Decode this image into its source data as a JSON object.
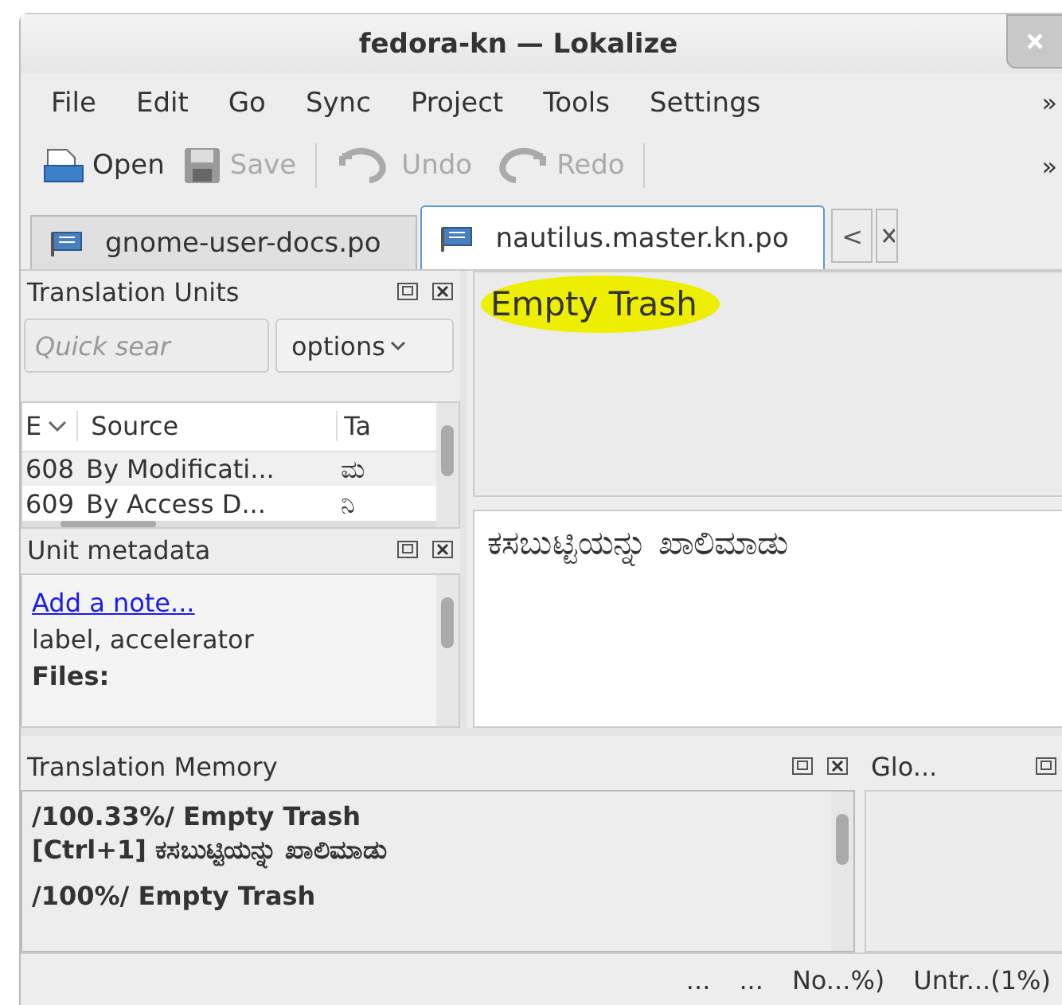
{
  "window": {
    "title": "fedora-kn — Lokalize"
  },
  "menu": {
    "items": [
      "File",
      "Edit",
      "Go",
      "Sync",
      "Project",
      "Tools",
      "Settings"
    ],
    "overflow": "»"
  },
  "toolbar": {
    "items": [
      {
        "kind": "open",
        "label": "Open",
        "disabled": false
      },
      {
        "kind": "save",
        "label": "Save",
        "disabled": true
      },
      {
        "kind": "undo",
        "label": "Undo",
        "disabled": true
      },
      {
        "kind": "redo",
        "label": "Redo",
        "disabled": true
      }
    ],
    "overflow": "»"
  },
  "tabs": [
    {
      "label": "gnome-user-docs.po",
      "selected": false
    },
    {
      "label": "nautilus.master.kn.po",
      "selected": true
    }
  ],
  "tab_scroll": "<",
  "translation_units": {
    "title": "Translation Units",
    "search": {
      "placeholder": "Quick sear"
    },
    "options": "options",
    "columns": [
      "E",
      "Source",
      "Ta"
    ],
    "rows": [
      {
        "cells": [
          "608",
          "By Modificati...",
          "ಮ"
        ]
      },
      {
        "cells": [
          "609",
          "By Access D...",
          "ನಿ"
        ]
      }
    ]
  },
  "unit_metadata": {
    "title": "Unit metadata",
    "link": "Add a note...",
    "text": "label, accelerator",
    "files_label": "Files:"
  },
  "editor": {
    "source": "Empty Trash",
    "source_highlighted": true,
    "target": "ಕಸಬುಟ್ಟಿಯನ್ನು ಖಾಲಿಮಾಡು"
  },
  "translation_memory": {
    "title": "Translation Memory",
    "entries": [
      {
        "lines": [
          "/100.33%/ Empty Trash",
          "[Ctrl+1] ಕಸಬುಟ್ಟಿಯನ್ನು ಖಾಲಿಮಾಡು"
        ]
      },
      {
        "lines": [
          "/100%/ Empty Trash"
        ]
      }
    ]
  },
  "glossary": {
    "title": "Glo..."
  },
  "status_bar": [
    "...",
    "...",
    "No...%)",
    "Untr...(1%)"
  ]
}
